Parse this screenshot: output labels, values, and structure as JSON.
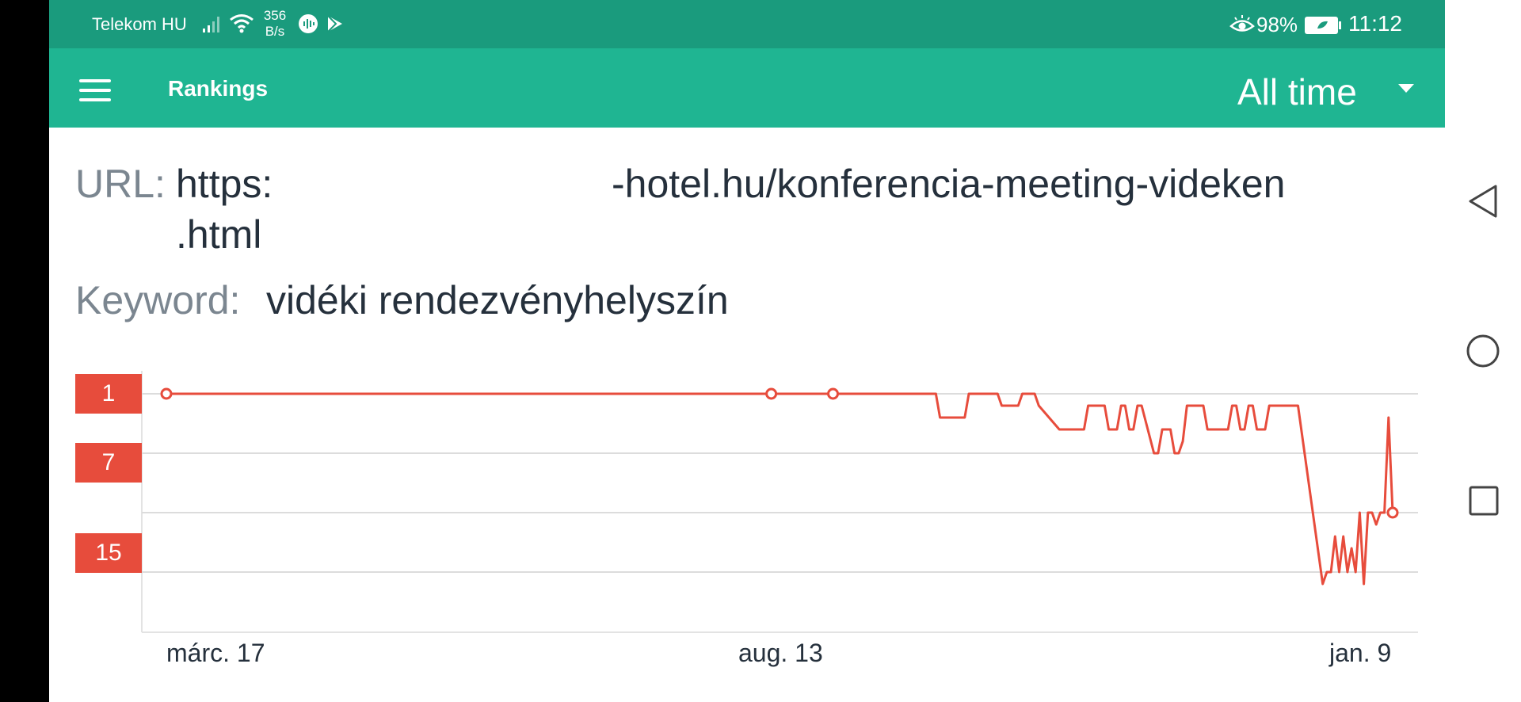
{
  "status_bar": {
    "carrier": "Telekom HU",
    "net_speed_value": "356",
    "net_speed_unit": "B/s",
    "battery": "98%",
    "time": "11:12"
  },
  "app_bar": {
    "title": "Rankings",
    "period": "All time"
  },
  "info": {
    "url_label": "URL:",
    "url_part1": "https:",
    "url_part2": "-hotel.hu/konferencia-meeting-videken",
    "url_part3": ".html",
    "keyword_label": "Keyword:",
    "keyword_value": "vidéki rendezvényhelyszín"
  },
  "chart_data": {
    "type": "line",
    "series": [
      {
        "color": "#e74c3c",
        "x": [
          "2018-03-17",
          "2018-04-15",
          "2018-05-15",
          "2018-06-15",
          "2018-07-15",
          "2018-08-11",
          "2018-08-26",
          "2018-09-05",
          "2018-09-20",
          "2018-09-21",
          "2018-09-27",
          "2018-09-28",
          "2018-10-05",
          "2018-10-06",
          "2018-10-10",
          "2018-10-11",
          "2018-10-14",
          "2018-10-15",
          "2018-10-20",
          "2018-10-26",
          "2018-10-27",
          "2018-10-31",
          "2018-11-01",
          "2018-11-03",
          "2018-11-04",
          "2018-11-05",
          "2018-11-06",
          "2018-11-07",
          "2018-11-08",
          "2018-11-09",
          "2018-11-12",
          "2018-11-13",
          "2018-11-14",
          "2018-11-16",
          "2018-11-17",
          "2018-11-18",
          "2018-11-19",
          "2018-11-20",
          "2018-11-24",
          "2018-11-25",
          "2018-11-30",
          "2018-12-01",
          "2018-12-02",
          "2018-12-03",
          "2018-12-04",
          "2018-12-05",
          "2018-12-06",
          "2018-12-07",
          "2018-12-09",
          "2018-12-10",
          "2018-12-12",
          "2018-12-16",
          "2018-12-17",
          "2018-12-23",
          "2018-12-24",
          "2018-12-25",
          "2018-12-26",
          "2018-12-27",
          "2018-12-28",
          "2018-12-29",
          "2018-12-30",
          "2018-12-31",
          "2019-01-01",
          "2019-01-02",
          "2019-01-03",
          "2019-01-04",
          "2019-01-05",
          "2019-01-06",
          "2019-01-07",
          "2019-01-08",
          "2019-01-09"
        ],
        "y": [
          1,
          1,
          1,
          1,
          1,
          1,
          1,
          1,
          1,
          3,
          3,
          1,
          1,
          2,
          2,
          1,
          1,
          2,
          4,
          4,
          2,
          2,
          4,
          4,
          2,
          2,
          4,
          4,
          2,
          2,
          6,
          6,
          4,
          4,
          6,
          6,
          5,
          2,
          2,
          4,
          4,
          2,
          2,
          4,
          4,
          2,
          2,
          4,
          4,
          2,
          2,
          2,
          2,
          17,
          16,
          16,
          13,
          16,
          13,
          16,
          14,
          16,
          11,
          17,
          11,
          11,
          12,
          11,
          11,
          3,
          11
        ]
      }
    ],
    "x_ticks": [
      "márc. 17",
      "aug. 13",
      "jan. 9"
    ],
    "y_ticks": [
      "1",
      "7",
      "15"
    ],
    "ylim": [
      1,
      20
    ],
    "y_inverted": true,
    "grid": true,
    "line_color": "#e74c3c"
  }
}
